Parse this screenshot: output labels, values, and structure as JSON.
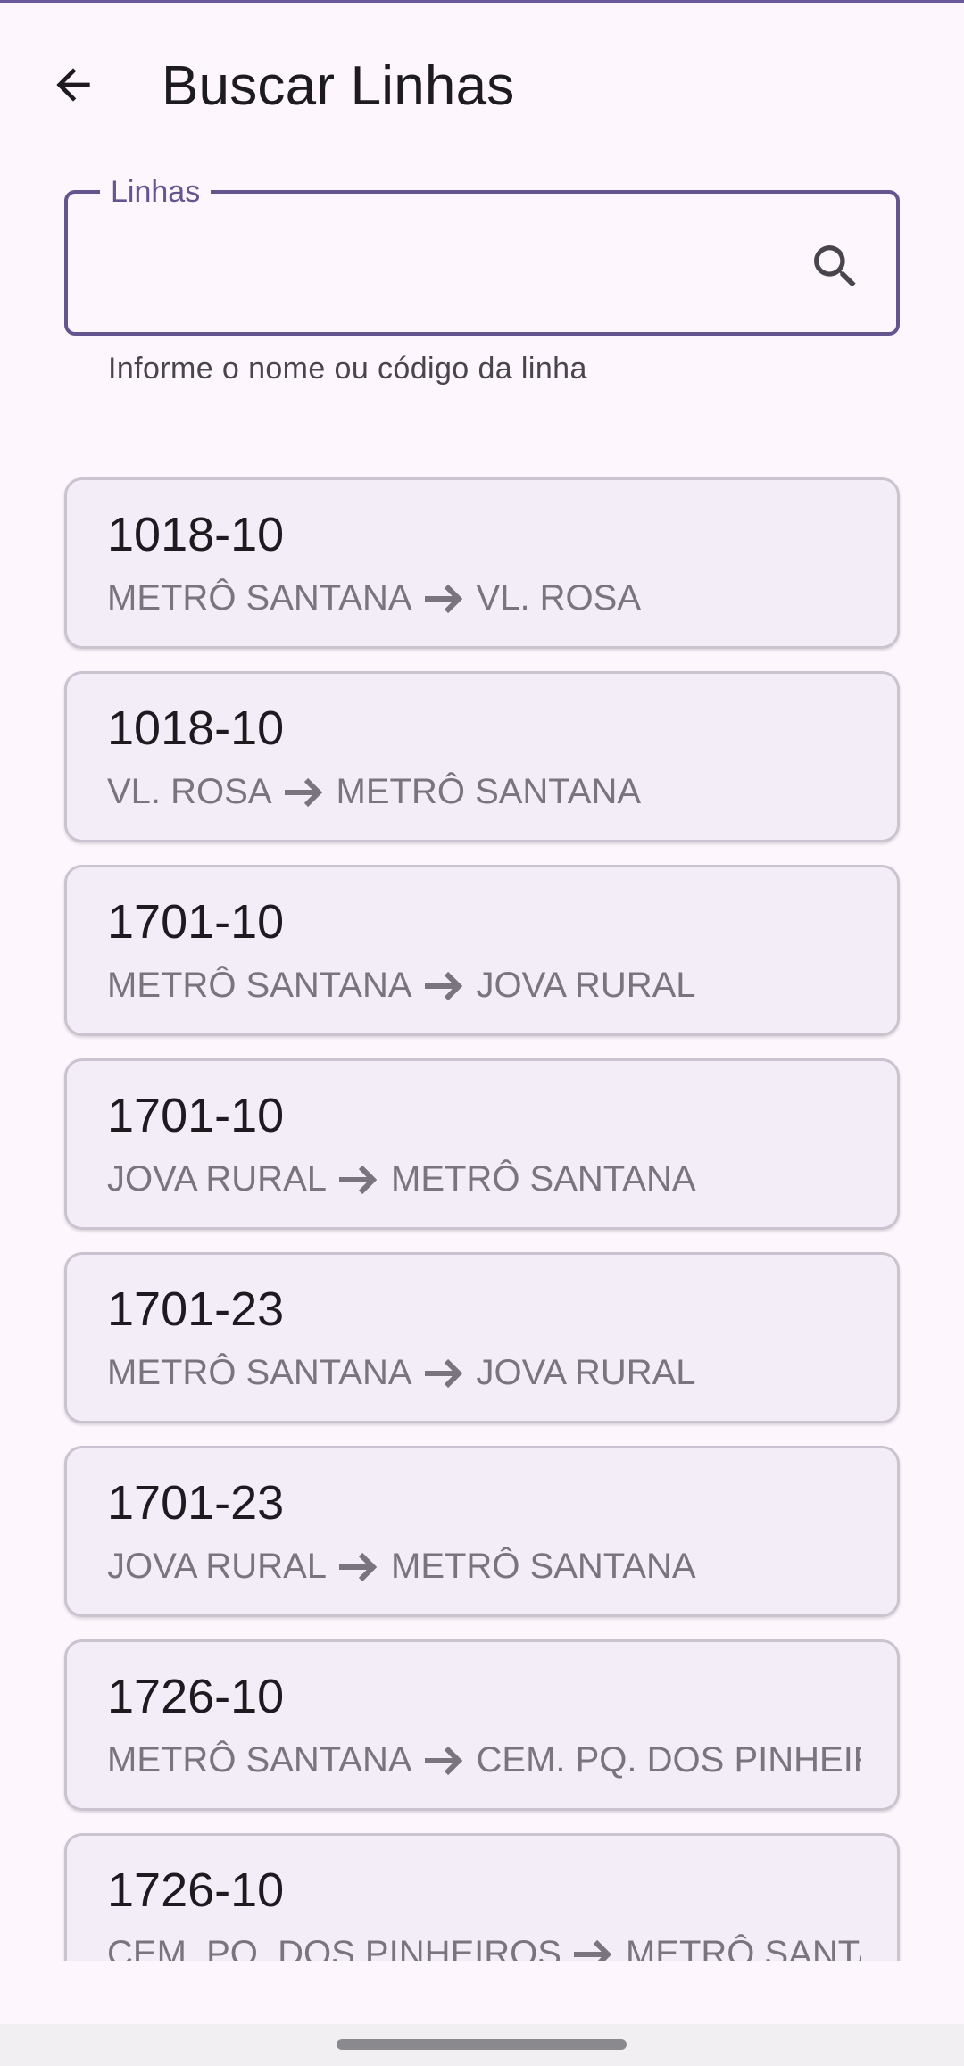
{
  "app_bar": {
    "title": "Buscar Linhas",
    "back_icon": "arrow-back-icon"
  },
  "search": {
    "label": "Linhas",
    "value": "",
    "placeholder": "",
    "helper": "Informe o nome ou código da linha",
    "icon": "search-icon"
  },
  "colors": {
    "accent": "#65558f",
    "card_bg": "#f3edf7",
    "card_border": "#cac4d0",
    "route_text": "#79747e",
    "background": "#fdf7fd"
  },
  "lines": [
    {
      "code": "1018-10",
      "from": "METRÔ SANTANA",
      "to": "VL. ROSA"
    },
    {
      "code": "1018-10",
      "from": "VL. ROSA",
      "to": "METRÔ SANTANA"
    },
    {
      "code": "1701-10",
      "from": "METRÔ SANTANA",
      "to": "JOVA RURAL"
    },
    {
      "code": "1701-10",
      "from": "JOVA RURAL",
      "to": "METRÔ SANTANA"
    },
    {
      "code": "1701-23",
      "from": "METRÔ SANTANA",
      "to": "JOVA RURAL"
    },
    {
      "code": "1701-23",
      "from": "JOVA RURAL",
      "to": "METRÔ SANTANA"
    },
    {
      "code": "1726-10",
      "from": "METRÔ SANTANA",
      "to": "CEM. PQ. DOS PINHEIROS"
    },
    {
      "code": "1726-10",
      "from": "CEM. PQ. DOS PINHEIROS",
      "to": "METRÔ SANTANA"
    }
  ]
}
